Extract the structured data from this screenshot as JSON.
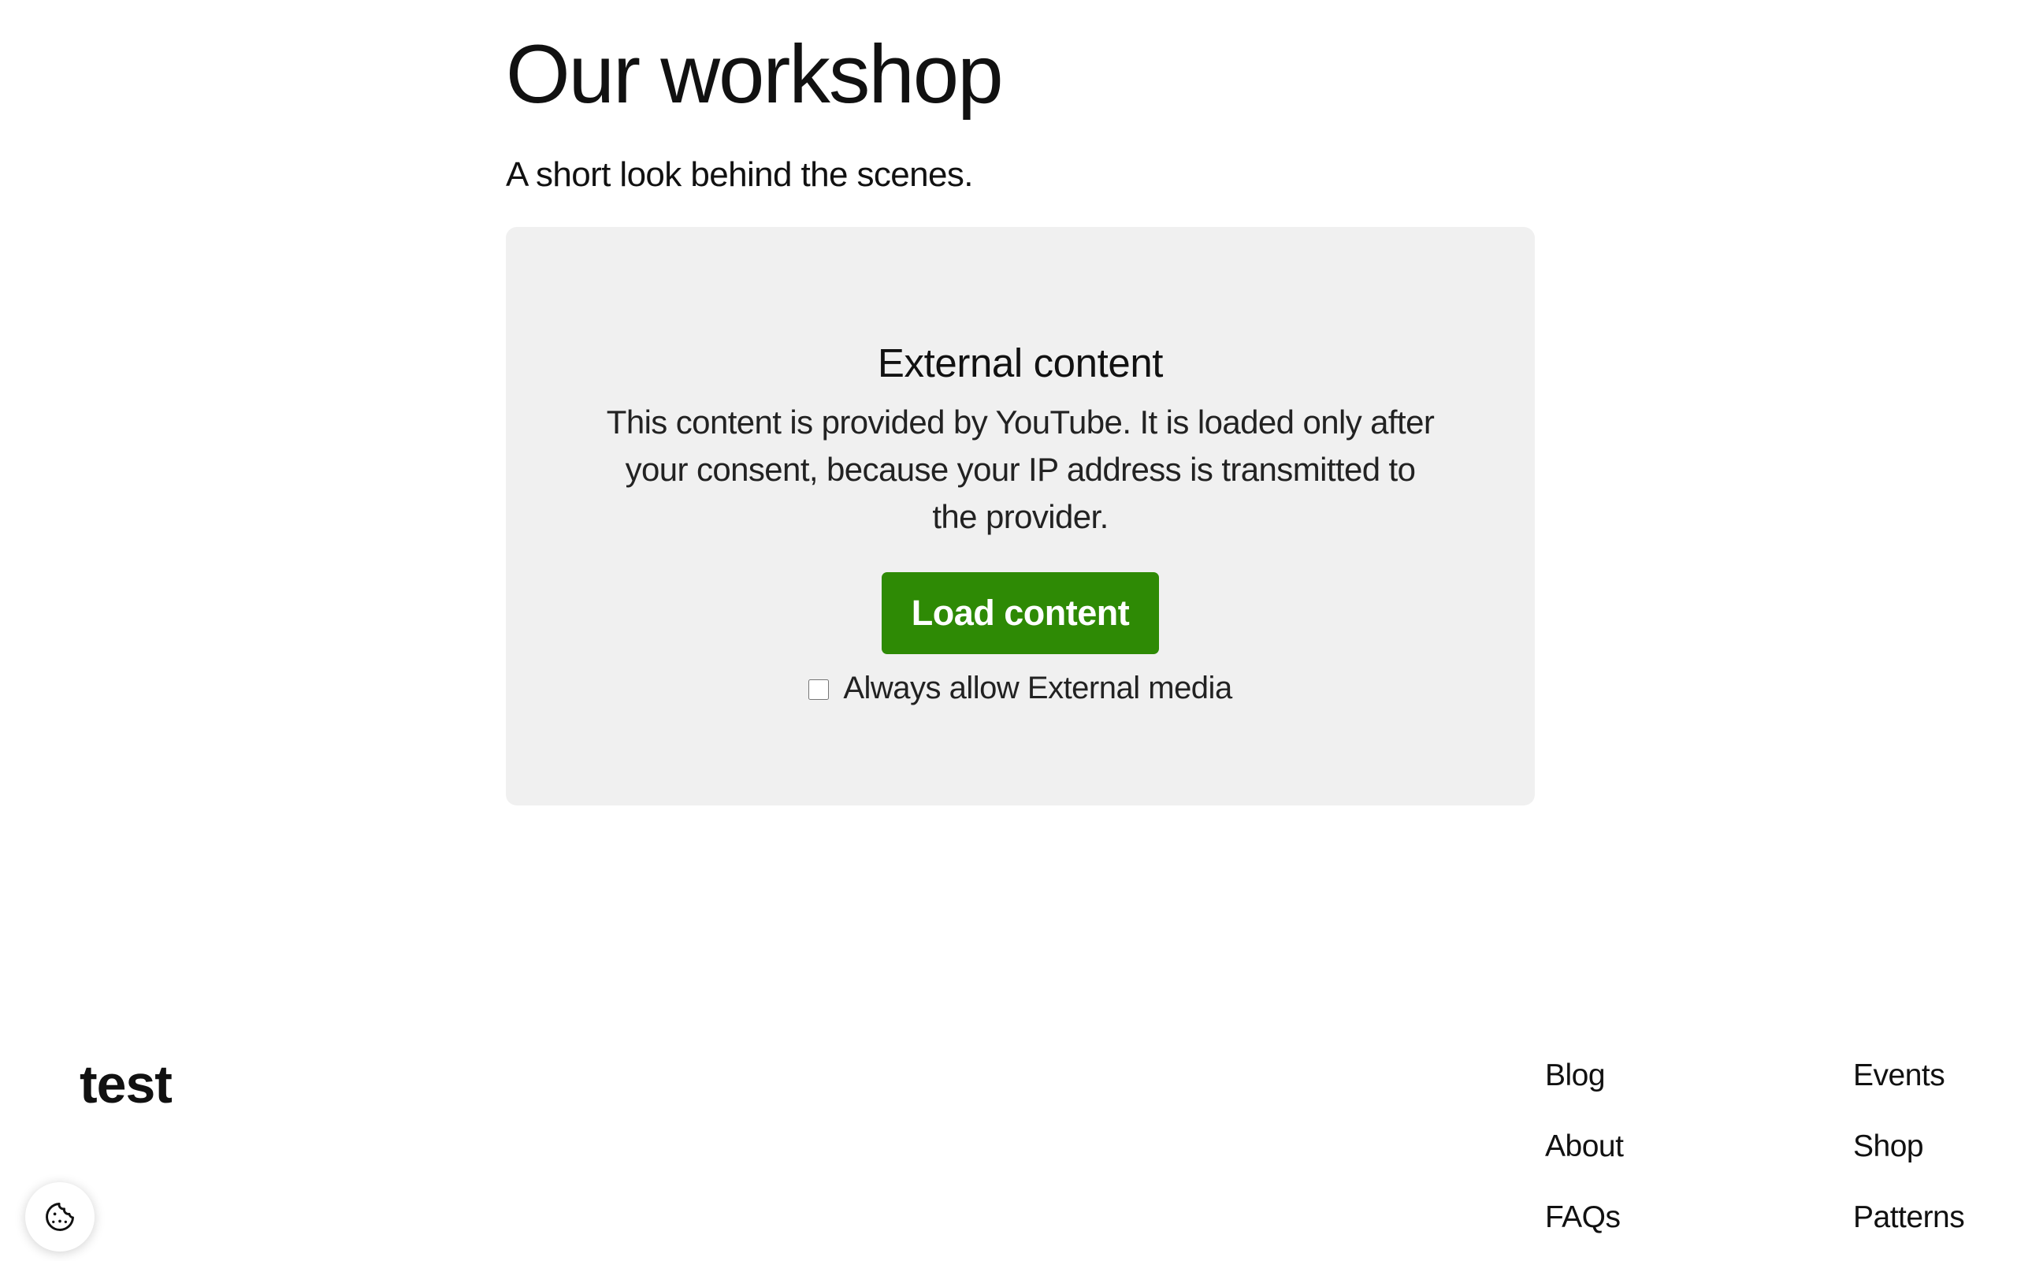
{
  "main": {
    "title": "Our workshop",
    "subtitle": "A short look behind the scenes."
  },
  "embed": {
    "heading": "External content",
    "description": "This content is provided by YouTube. It is loaded only after your consent, because your IP address is transmitted to the provider.",
    "load_button_label": "Load content",
    "always_allow_label": "Always allow External media",
    "always_allow_checked": false,
    "button_color": "#2e8a05",
    "box_color": "#f0f0f0"
  },
  "footer": {
    "logo": "test",
    "nav_col_1": [
      "Blog",
      "About",
      "FAQs"
    ],
    "nav_col_2": [
      "Events",
      "Shop",
      "Patterns"
    ]
  },
  "cookie_settings": {
    "icon": "cookie-icon"
  }
}
